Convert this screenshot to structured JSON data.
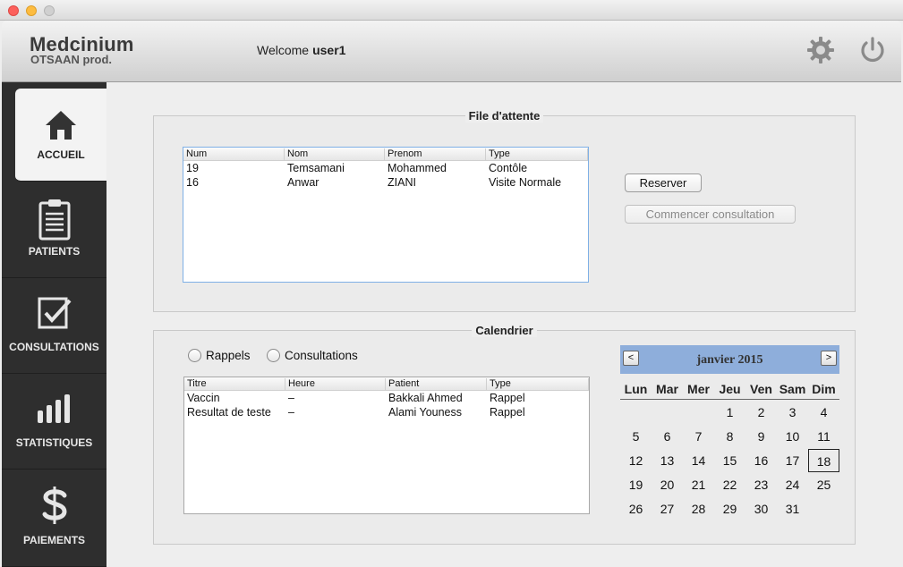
{
  "header": {
    "brand": "Medcinium",
    "brand_sub": "OTSAAN prod.",
    "welcome_label": "Welcome",
    "username": "user1"
  },
  "sidebar": {
    "items": [
      {
        "label": "ACCUEIL",
        "icon": "home-icon"
      },
      {
        "label": "PATIENTS",
        "icon": "clipboard-icon"
      },
      {
        "label": "CONSULTATIONS",
        "icon": "checkbox-icon"
      },
      {
        "label": "STATISTIQUES",
        "icon": "bars-icon"
      },
      {
        "label": "PAIEMENTS",
        "icon": "dollar-icon"
      }
    ]
  },
  "queue": {
    "title": "File d'attente",
    "columns": [
      "Num",
      "Nom",
      "Prenom",
      "Type"
    ],
    "rows": [
      [
        "19",
        "Temsamani",
        "Mohammed",
        "Contôle"
      ],
      [
        "16",
        "Anwar",
        "ZIANI",
        "Visite Normale"
      ]
    ],
    "reserve_label": "Reserver",
    "start_label": "Commencer consultation"
  },
  "calendar_panel": {
    "title": "Calendrier",
    "radio_rappels": "Rappels",
    "radio_consultations": "Consultations",
    "columns": [
      "Titre",
      "Heure",
      "Patient",
      "Type"
    ],
    "rows": [
      [
        "Vaccin",
        "–",
        "Bakkali Ahmed",
        "Rappel"
      ],
      [
        "Resultat de teste",
        "–",
        "Alami Youness",
        "Rappel"
      ]
    ]
  },
  "calendar": {
    "month_label": "janvier 2015",
    "prev": "<",
    "next": ">",
    "weekdays": [
      "Lun",
      "Mar",
      "Mer",
      "Jeu",
      "Ven",
      "Sam",
      "Dim"
    ],
    "first_weekday_index": 3,
    "days_in_month": 31,
    "selected_day": 18
  }
}
